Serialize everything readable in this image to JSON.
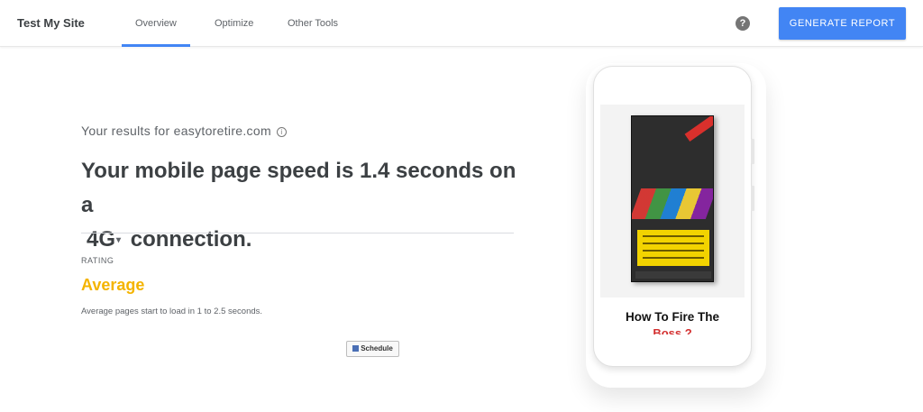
{
  "header": {
    "brand": "Test My Site",
    "tabs": [
      {
        "label": "Overview",
        "active": true
      },
      {
        "label": "Optimize",
        "active": false
      },
      {
        "label": "Other Tools",
        "active": false
      }
    ],
    "help_icon": "question-circle-icon",
    "generate_report_label": "GENERATE REPORT"
  },
  "results": {
    "results_for": "Your results for easytoretire.com",
    "info_icon": "info-icon",
    "headline_prefix": "Your mobile page speed is 1.4 seconds on a",
    "connection": "4G",
    "headline_suffix": "connection."
  },
  "rating": {
    "label": "RATING",
    "value": "Average",
    "description": "Average pages start to load in 1 to 2.5 seconds.",
    "color": "#f4b400"
  },
  "schedule_button": "Schedule",
  "phone_preview": {
    "page_heading_line1": "How To Fire The",
    "page_heading_line2": "Boss ?"
  },
  "colors": {
    "accent": "#4285f4",
    "rating_average": "#f4b400"
  }
}
